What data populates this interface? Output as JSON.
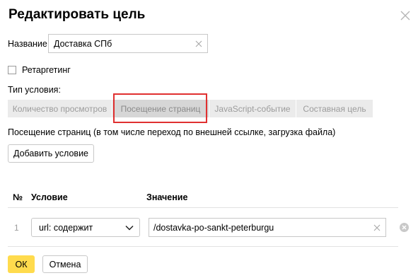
{
  "dialog": {
    "title": "Редактировать цель"
  },
  "name_field": {
    "label": "Название",
    "value": "Доставка СПб",
    "clear_icon": "cross-icon"
  },
  "retargeting": {
    "label": "Ретаргетинг",
    "checked": false
  },
  "condition_type": {
    "label": "Тип условия:",
    "tabs": [
      {
        "label": "Количество просмотров",
        "active": false
      },
      {
        "label": "Посещение страниц",
        "active": true
      },
      {
        "label": "JavaScript-событие",
        "active": false
      },
      {
        "label": "Составная цель",
        "active": false
      }
    ],
    "highlight_color": "#e03030"
  },
  "description": "Посещение страниц (в том числе переход по внешней ссылке, загрузка файла)",
  "add_condition_label": "Добавить условие",
  "table": {
    "headers": {
      "num": "№",
      "condition": "Условие",
      "value": "Значение"
    },
    "rows": [
      {
        "num": "1",
        "condition": "url: содержит",
        "value": "/dostavka-po-sankt-peterburgu"
      }
    ]
  },
  "footer": {
    "ok_label": "ОК",
    "cancel_label": "Отмена"
  },
  "colors": {
    "accent": "#ffdb4d",
    "highlight": "#e03030"
  }
}
